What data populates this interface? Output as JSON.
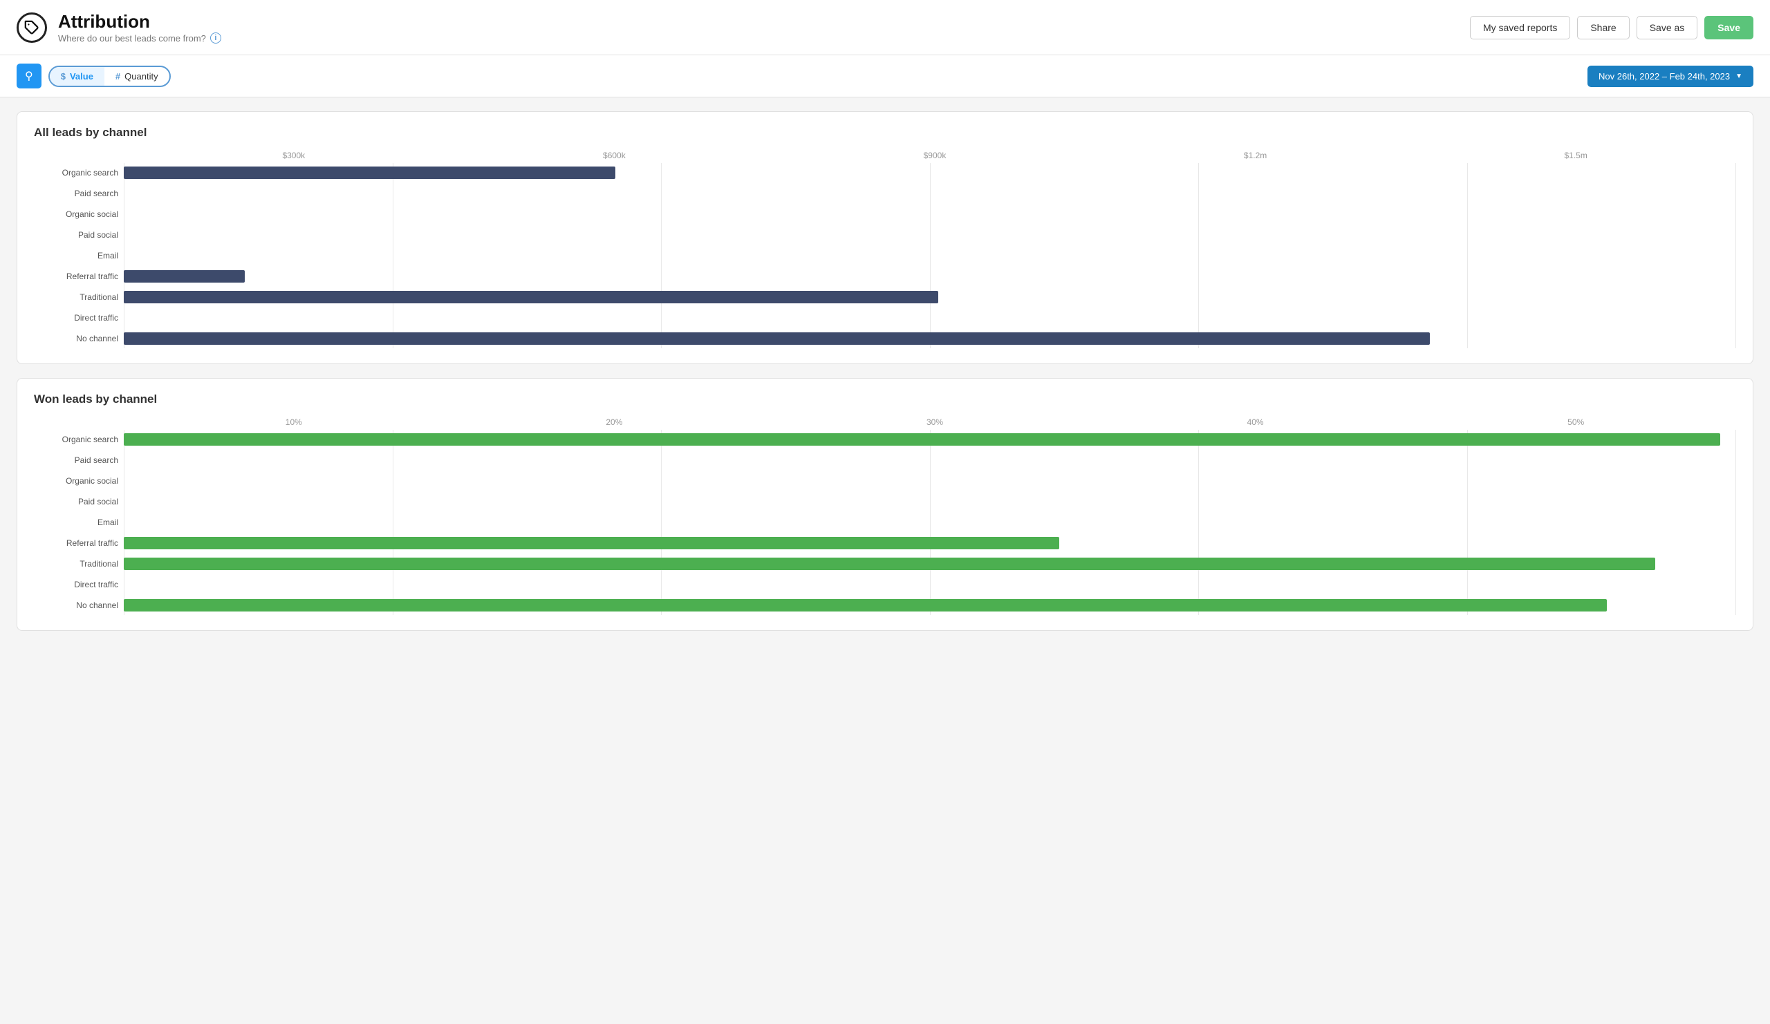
{
  "header": {
    "title": "Attribution",
    "subtitle": "Where do our best leads come from?",
    "logo_symbol": "🏷",
    "buttons": {
      "saved_reports": "My saved reports",
      "share": "Share",
      "save_as": "Save as",
      "save": "Save"
    }
  },
  "toolbar": {
    "toggle": {
      "value_symbol": "$",
      "value_label": "Value",
      "quantity_symbol": "#",
      "quantity_label": "Quantity"
    },
    "date_range": "Nov 26th, 2022 – Feb 24th, 2023"
  },
  "chart1": {
    "title": "All leads by channel",
    "x_labels": [
      "$300k",
      "$600k",
      "$900k",
      "$1.2m",
      "$1.5m"
    ],
    "channels": [
      {
        "label": "Organic search",
        "value": 0.305
      },
      {
        "label": "Paid search",
        "value": 0
      },
      {
        "label": "Organic social",
        "value": 0
      },
      {
        "label": "Paid social",
        "value": 0
      },
      {
        "label": "Email",
        "value": 0
      },
      {
        "label": "Referral traffic",
        "value": 0.075
      },
      {
        "label": "Traditional",
        "value": 0.505
      },
      {
        "label": "Direct traffic",
        "value": 0
      },
      {
        "label": "No channel",
        "value": 0.81
      }
    ]
  },
  "chart2": {
    "title": "Won leads by channel",
    "x_labels": [
      "10%",
      "20%",
      "30%",
      "40%",
      "50%"
    ],
    "channels": [
      {
        "label": "Organic search",
        "value": 0.99
      },
      {
        "label": "Paid search",
        "value": 0
      },
      {
        "label": "Organic social",
        "value": 0
      },
      {
        "label": "Paid social",
        "value": 0
      },
      {
        "label": "Email",
        "value": 0
      },
      {
        "label": "Referral traffic",
        "value": 0.58
      },
      {
        "label": "Traditional",
        "value": 0.95
      },
      {
        "label": "Direct traffic",
        "value": 0
      },
      {
        "label": "No channel",
        "value": 0.92
      }
    ]
  }
}
